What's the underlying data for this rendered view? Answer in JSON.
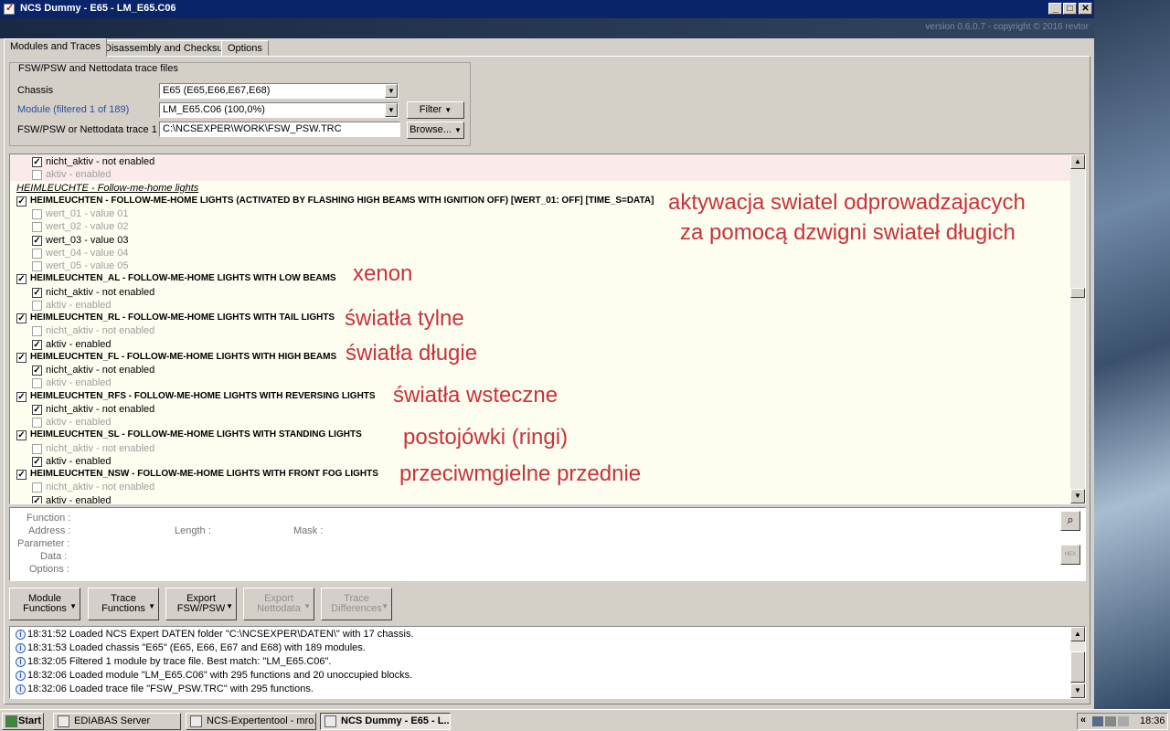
{
  "window": {
    "title": "NCS Dummy - E65 - LM_E65.C06",
    "controls": {
      "minimize": "_",
      "maximize": "□",
      "close": "✕"
    }
  },
  "banner": {
    "version": "version 0.6.0.7 - copyright © 2016 revtor"
  },
  "tabs": [
    {
      "label": "Modules and Traces",
      "active": true
    },
    {
      "label": "Disassembly and Checksums",
      "active": false
    },
    {
      "label": "Options",
      "active": false
    }
  ],
  "files": {
    "legend": "FSW/PSW and Nettodata trace files",
    "chassis_label": "Chassis",
    "chassis_value": "E65  (E65,E66,E67,E68)",
    "module_label": "Module (filtered 1 of 189)",
    "module_value": "LM_E65.C06  (100,0%)",
    "trace_label": "FSW/PSW or Nettodata trace 1",
    "trace_value": "C:\\NCSEXPER\\WORK\\FSW_PSW.TRC",
    "filter_label": "Filter",
    "browse_label": "Browse..."
  },
  "functions": [
    {
      "kind": "option",
      "checked": true,
      "enabled": true,
      "text": "nicht_aktiv  -  not enabled"
    },
    {
      "kind": "option",
      "checked": false,
      "enabled": false,
      "text": "aktiv  -  enabled"
    },
    {
      "kind": "section",
      "text": "HEIMLEUCHTE  -  Follow-me-home lights"
    },
    {
      "kind": "function",
      "checked": true,
      "text": "HEIMLEUCHTEN  -  FOLLOW-ME-HOME LIGHTS (ACTIVATED BY FLASHING HIGH BEAMS WITH IGNITION OFF) [WERT_01: OFF] [TIME_S=DATA]"
    },
    {
      "kind": "option",
      "checked": false,
      "enabled": false,
      "text": "wert_01  -  value 01"
    },
    {
      "kind": "option",
      "checked": false,
      "enabled": false,
      "text": "wert_02  -  value 02"
    },
    {
      "kind": "option",
      "checked": true,
      "enabled": true,
      "text": "wert_03  -  value 03"
    },
    {
      "kind": "option",
      "checked": false,
      "enabled": false,
      "text": "wert_04  -  value 04"
    },
    {
      "kind": "option",
      "checked": false,
      "enabled": false,
      "text": "wert_05  -  value 05"
    },
    {
      "kind": "function",
      "checked": true,
      "text": "HEIMLEUCHTEN_AL  -  FOLLOW-ME-HOME LIGHTS WITH LOW BEAMS"
    },
    {
      "kind": "option",
      "checked": true,
      "enabled": true,
      "text": "nicht_aktiv  -  not enabled"
    },
    {
      "kind": "option",
      "checked": false,
      "enabled": false,
      "text": "aktiv  -  enabled"
    },
    {
      "kind": "function",
      "checked": true,
      "text": "HEIMLEUCHTEN_RL  -  FOLLOW-ME-HOME LIGHTS WITH TAIL LIGHTS"
    },
    {
      "kind": "option",
      "checked": false,
      "enabled": false,
      "text": "nicht_aktiv  -  not enabled"
    },
    {
      "kind": "option",
      "checked": true,
      "enabled": true,
      "text": "aktiv  -  enabled"
    },
    {
      "kind": "function",
      "checked": true,
      "text": "HEIMLEUCHTEN_FL  -  FOLLOW-ME-HOME LIGHTS WITH HIGH BEAMS"
    },
    {
      "kind": "option",
      "checked": true,
      "enabled": true,
      "text": "nicht_aktiv  -  not enabled"
    },
    {
      "kind": "option",
      "checked": false,
      "enabled": false,
      "text": "aktiv  -  enabled"
    },
    {
      "kind": "function",
      "checked": true,
      "text": "HEIMLEUCHTEN_RFS  -  FOLLOW-ME-HOME LIGHTS WITH REVERSING LIGHTS"
    },
    {
      "kind": "option",
      "checked": true,
      "enabled": true,
      "text": "nicht_aktiv  -  not enabled"
    },
    {
      "kind": "option",
      "checked": false,
      "enabled": false,
      "text": "aktiv  -  enabled"
    },
    {
      "kind": "function",
      "checked": true,
      "text": "HEIMLEUCHTEN_SL  -  FOLLOW-ME-HOME LIGHTS WITH STANDING LIGHTS"
    },
    {
      "kind": "option",
      "checked": false,
      "enabled": false,
      "text": "nicht_aktiv  -  not enabled"
    },
    {
      "kind": "option",
      "checked": true,
      "enabled": true,
      "text": "aktiv  -  enabled"
    },
    {
      "kind": "function",
      "checked": true,
      "text": "HEIMLEUCHTEN_NSW  -  FOLLOW-ME-HOME LIGHTS WITH FRONT FOG LIGHTS"
    },
    {
      "kind": "option",
      "checked": false,
      "enabled": false,
      "text": "nicht_aktiv  -  not enabled"
    },
    {
      "kind": "option",
      "checked": true,
      "enabled": true,
      "text": "aktiv  -  enabled"
    }
  ],
  "annotations": [
    "aktywacja swiatel odprowadzajacych",
    "za pomocą dzwigni swiateł długich",
    "xenon",
    "światła tylne",
    "światła długie",
    "światła wsteczne",
    "postojówki (ringi)",
    "przeciwmgielne przednie"
  ],
  "details": {
    "function_label": "Function :",
    "address_label": "Address :",
    "length_label": "Length :",
    "mask_label": "Mask :",
    "parameter_label": "Parameter :",
    "data_label": "Data :",
    "options_label": "Options :",
    "hex_label": "HEX"
  },
  "toolbar": [
    {
      "line1": "Module",
      "line2": "Functions",
      "enabled": true
    },
    {
      "line1": "Trace",
      "line2": "Functions",
      "enabled": true
    },
    {
      "line1": "Export",
      "line2": "FSW/PSW",
      "enabled": true
    },
    {
      "line1": "Export",
      "line2": "Nettodata",
      "enabled": false
    },
    {
      "line1": "Trace",
      "line2": "Differences",
      "enabled": false
    }
  ],
  "log": [
    "18:31:52  Loaded NCS Expert DATEN folder \"C:\\NCSEXPER\\DATEN\\\" with 17 chassis.",
    "18:31:53  Loaded chassis \"E65\" (E65, E66, E67 and E68) with 189 modules.",
    "18:32:05  Filtered 1 module by trace file. Best match: \"LM_E65.C06\".",
    "18:32:06  Loaded module \"LM_E65.C06\" with 295 functions and 20 unoccupied blocks.",
    "18:32:06  Loaded trace file \"FSW_PSW.TRC\" with 295 functions."
  ],
  "taskbar": {
    "start": "Start",
    "tasks": [
      {
        "label": "EDIABAS Server",
        "active": false
      },
      {
        "label": "NCS-Expertentool - mro...",
        "active": false
      },
      {
        "label": "NCS Dummy - E65 - L...",
        "active": true
      }
    ],
    "clock": "18:36",
    "tray_chevron": "«"
  },
  "colors": {
    "annotation": "#c8333a",
    "title_bar": "#0a246a",
    "list_bg": "#fdfdf0"
  }
}
